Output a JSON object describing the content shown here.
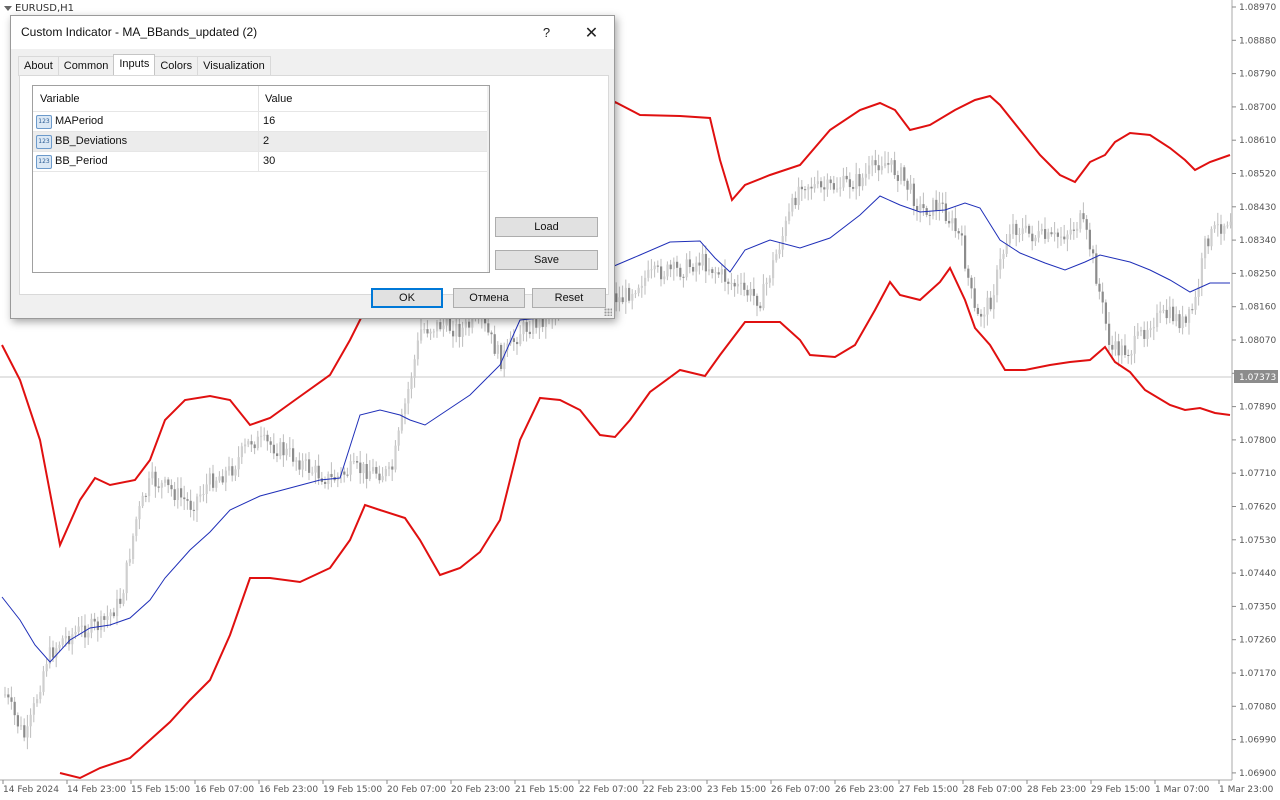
{
  "chart": {
    "symbol": "EURUSD,H1",
    "current_price": "1.07373",
    "price_labels": [
      "1.08970",
      "1.08880",
      "1.08790",
      "1.08700",
      "1.08610",
      "1.08520",
      "1.08430",
      "1.08340",
      "1.08250",
      "1.08160",
      "1.08070",
      "1.07980",
      "1.07890",
      "1.07800",
      "1.07710",
      "1.07620",
      "1.07530",
      "1.07440",
      "1.07350",
      "1.07260",
      "1.07170",
      "1.07080",
      "1.06990",
      "1.06900"
    ],
    "time_labels": [
      "14 Feb 2024",
      "14 Feb 23:00",
      "15 Feb 15:00",
      "16 Feb 07:00",
      "16 Feb 23:00",
      "19 Feb 15:00",
      "20 Feb 07:00",
      "20 Feb 23:00",
      "21 Feb 15:00",
      "22 Feb 07:00",
      "22 Feb 23:00",
      "23 Feb 15:00",
      "26 Feb 07:00",
      "26 Feb 23:00",
      "27 Feb 15:00",
      "28 Feb 07:00",
      "28 Feb 23:00",
      "29 Feb 15:00",
      "1 Mar 07:00",
      "1 Mar 23:00"
    ],
    "colors": {
      "upper_band": "#e01010",
      "lower_band": "#e01010",
      "ma_line": "#1f2fb8",
      "candles": "#8c8c8c",
      "background": "#ffffff",
      "grid_text": "#555555"
    }
  },
  "dialog": {
    "title": "Custom Indicator - MA_BBands_updated (2)",
    "help_label": "?",
    "close_label": "✕",
    "tabs": [
      "About",
      "Common",
      "Inputs",
      "Colors",
      "Visualization"
    ],
    "active_tab": "Inputs",
    "table": {
      "headers": [
        "Variable",
        "Value"
      ],
      "rows": [
        {
          "variable": "MAPeriod",
          "value": "16",
          "icon": "123-icon"
        },
        {
          "variable": "BB_Deviations",
          "value": "2",
          "icon": "123-icon"
        },
        {
          "variable": "BB_Period",
          "value": "30",
          "icon": "123-icon"
        }
      ],
      "selected_row": 1
    },
    "buttons": {
      "load": "Load",
      "save": "Save",
      "ok": "OK",
      "cancel": "Отмена",
      "reset": "Reset"
    }
  }
}
